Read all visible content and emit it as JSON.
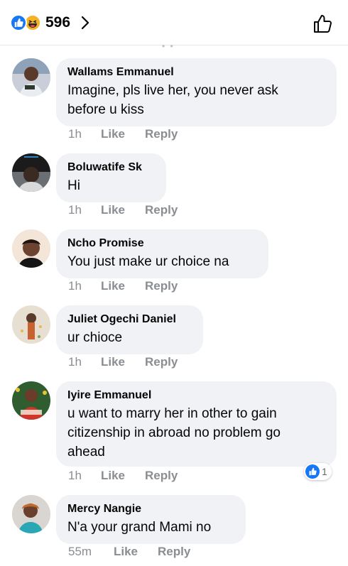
{
  "header": {
    "reaction_count": "596",
    "reaction_icons": [
      "like-icon",
      "haha-icon"
    ],
    "like_color": "#1877f2",
    "haha_color": "#f7b125"
  },
  "comments": [
    {
      "author": "Wallams Emmanuel",
      "text_lines": [
        "Imagine, pls live her, you never ask",
        "before u kiss"
      ],
      "time": "1h",
      "like": "Like",
      "reply": "Reply"
    },
    {
      "author": "Boluwatife Sk",
      "text_lines": [
        "Hi"
      ],
      "time": "1h",
      "like": "Like",
      "reply": "Reply"
    },
    {
      "author": "Ncho Promise",
      "text_lines": [
        "You just make ur choice na"
      ],
      "time": "1h",
      "like": "Like",
      "reply": "Reply"
    },
    {
      "author": "Juliet Ogechi Daniel",
      "text_lines": [
        "ur chioce"
      ],
      "time": "1h",
      "like": "Like",
      "reply": "Reply"
    },
    {
      "author": "Iyire Emmanuel",
      "text_lines": [
        "u want to marry her in other to gain",
        "citizenship in abroad no problem go",
        "ahead"
      ],
      "time": "1h",
      "like": "Like",
      "reply": "Reply",
      "reaction_count": "1"
    },
    {
      "author": "Mercy Nangie",
      "text_lines": [
        "N'a your grand Mami no"
      ],
      "time": "55m",
      "like": "Like",
      "reply": "Reply"
    }
  ]
}
